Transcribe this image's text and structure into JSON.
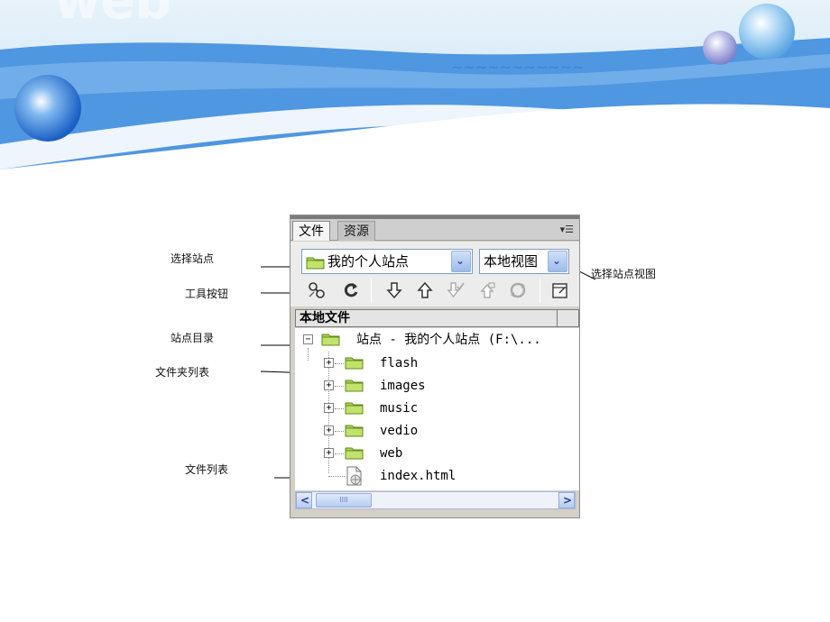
{
  "annotations": {
    "select_site": "选择站点",
    "toolbar_buttons": "工具按钮",
    "site_directory": "站点目录",
    "folder_list": "文件夹列表",
    "file_list": "文件列表",
    "select_site_view": "选择站点视图"
  },
  "panel": {
    "tabs": [
      {
        "label": "文件",
        "active": true
      },
      {
        "label": "资源",
        "active": false
      }
    ],
    "menu_icon": "panel-options-icon",
    "site_select": {
      "value": "我的个人站点"
    },
    "view_select": {
      "value": "本地视图"
    },
    "toolbar": [
      "connect-icon",
      "refresh-icon",
      "get-icon",
      "put-icon",
      "check-out-icon",
      "check-in-icon",
      "synchronize-icon",
      "expand-icon"
    ],
    "column_header": "本地文件",
    "tree": {
      "root": "站点 - 我的个人站点 (F:\\...",
      "folders": [
        "flash",
        "images",
        "music",
        "vedio",
        "web"
      ],
      "files": [
        "index.html"
      ]
    },
    "scroll_thumb": "IIII"
  },
  "colors": {
    "banner_blue": "#4a90dd",
    "folder_green": "#8fc43a",
    "scroll_blue": "#b8cdf1"
  }
}
